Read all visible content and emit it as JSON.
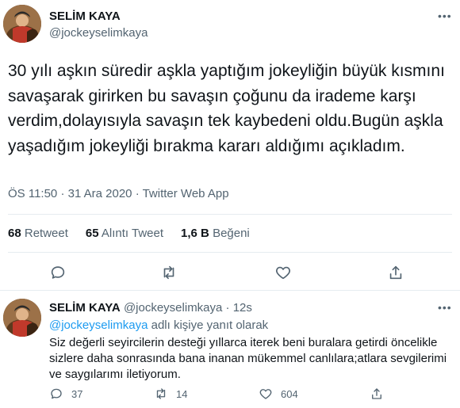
{
  "tweet": {
    "author_name": "SELİM KAYA",
    "author_handle": "@jockeyselimkaya",
    "text": "30 yılı aşkın süredir aşkla yaptığım jokeyliğin büyük kısmını savaşarak girirken bu savaşın çoğunu da irademe karşı verdim,dolayısıyla savaşın tek kaybedeni oldu.Bugün aşkla yaşadığım jokeyliği bırakma kararı aldığımı açıkladım.",
    "time": "ÖS 11:50",
    "date": "31 Ara 2020",
    "separator": "·",
    "source": "Twitter Web App",
    "more_icon": "more-horizontal-icon"
  },
  "stats": {
    "retweets_count": "68",
    "retweets_label": "Retweet",
    "quotes_count": "65",
    "quotes_label": "Alıntı Tweet",
    "likes_count": "1,6 B",
    "likes_label": "Beğeni"
  },
  "actions": {
    "icons": [
      "reply-icon",
      "retweet-icon",
      "like-icon",
      "share-icon"
    ]
  },
  "reply": {
    "author_name": "SELİM KAYA",
    "author_handle": "@jockeyselimkaya",
    "separator": "·",
    "time": "12s",
    "reply_to_mention": "@jockeyselimkaya",
    "reply_to_suffix": "adlı kişiye yanıt olarak",
    "text": "Siz değerli seyircilerin desteği yıllarca iterek beni buralara getirdi öncelikle sizlere daha sonrasında bana inanan mükemmel canlılara;atlara sevgilerimi ve saygılarımı iletiyorum.",
    "reply_count": "37",
    "retweet_count": "14",
    "like_count": "604"
  },
  "colors": {
    "text": "#0f1419",
    "secondary": "#536471",
    "accent": "#1d9bf0",
    "divider": "#e6ecf0"
  }
}
